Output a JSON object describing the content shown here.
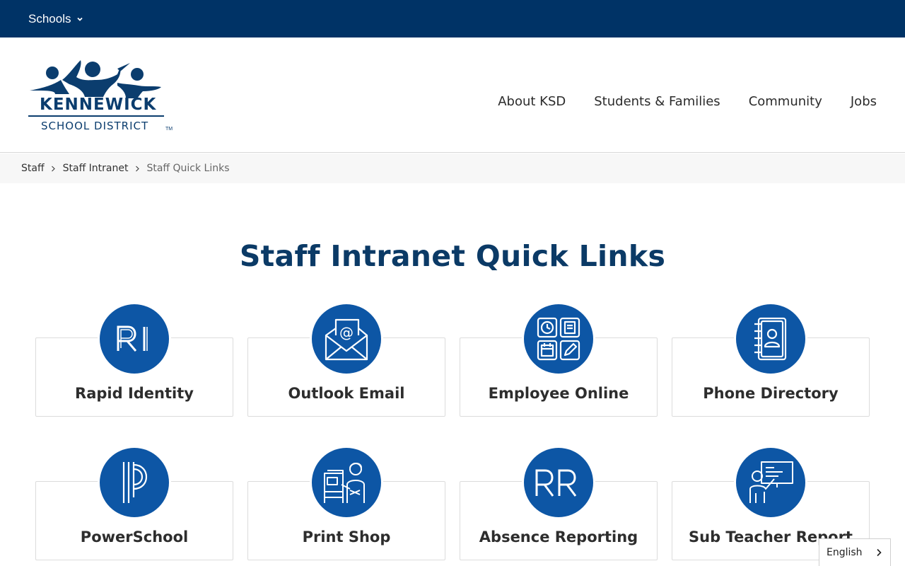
{
  "topbar": {
    "schools_label": "Schools"
  },
  "logo": {
    "name": "KENNEWICK",
    "subtitle": "SCHOOL DISTRICT",
    "tm": "TM"
  },
  "nav": {
    "items": [
      {
        "label": "About KSD"
      },
      {
        "label": "Students & Families"
      },
      {
        "label": "Community"
      },
      {
        "label": "Jobs"
      }
    ]
  },
  "breadcrumb": {
    "items": [
      {
        "label": "Staff"
      },
      {
        "label": "Staff Intranet"
      },
      {
        "label": "Staff Quick Links"
      }
    ]
  },
  "page": {
    "title": "Staff Intranet Quick Links"
  },
  "links": [
    {
      "label": "Rapid Identity",
      "icon": "rapid-identity-icon"
    },
    {
      "label": "Outlook Email",
      "icon": "envelope-icon"
    },
    {
      "label": "Employee Online",
      "icon": "app-grid-icon"
    },
    {
      "label": "Phone Directory",
      "icon": "address-book-icon"
    },
    {
      "label": "PowerSchool",
      "icon": "powerschool-icon"
    },
    {
      "label": "Print Shop",
      "icon": "print-shop-icon"
    },
    {
      "label": "Absence Reporting",
      "icon": "absence-reporting-icon"
    },
    {
      "label": "Sub Teacher Report",
      "icon": "teacher-whiteboard-icon"
    }
  ],
  "language": {
    "selected": "English"
  },
  "colors": {
    "brand_navy": "#003366",
    "icon_blue": "#0d56a5",
    "title_navy": "#0b3a66"
  }
}
